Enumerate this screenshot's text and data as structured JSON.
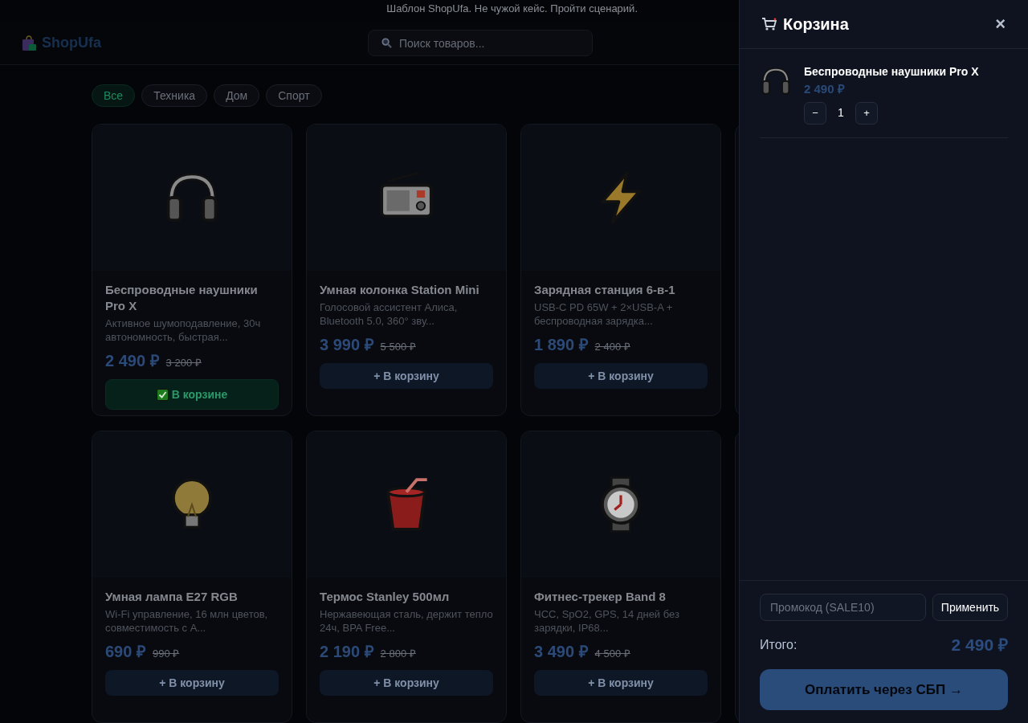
{
  "banner": "Шаблон ShopUfa. Не чужой кейс. Пройти сценарий.",
  "logo": "ShopUfa",
  "search": {
    "placeholder": "Поиск товаров..."
  },
  "categories": [
    {
      "label": "Все",
      "selected": true
    },
    {
      "label": "Техника",
      "selected": false
    },
    {
      "label": "Дом",
      "selected": false
    },
    {
      "label": "Спорт",
      "selected": false
    }
  ],
  "products": [
    {
      "title": "Беспроводные наушники Pro X",
      "description": "Активное шумоподавление, 30ч автономность, быстрая...",
      "price": "2 490 ₽",
      "old_price": "3 200 ₽",
      "in_cart": true,
      "button": "В корзине"
    },
    {
      "title": "Умная колонка Station Mini",
      "description": "Голосовой ассистент Алиса, Bluetooth 5.0, 360° зву...",
      "price": "3 990 ₽",
      "old_price": "5 500 ₽",
      "in_cart": false,
      "button": "+ В корзину"
    },
    {
      "title": "Зарядная станция 6-в-1",
      "description": "USB-C PD 65W + 2×USB-A + беспроводная зарядка...",
      "price": "1 890 ₽",
      "old_price": "2 400 ₽",
      "in_cart": false,
      "button": "+ В корзину"
    },
    {
      "title": "Умная лампа E27 RGB",
      "description": "Wi-Fi управление, 16 млн цветов, совместимость с А...",
      "price": "690 ₽",
      "old_price": "990 ₽",
      "in_cart": false,
      "button": "+ В корзину"
    },
    {
      "title": "Термос Stanley 500мл",
      "description": "Нержавеющая сталь, держит тепло 24ч, BPA Free...",
      "price": "2 190 ₽",
      "old_price": "2 800 ₽",
      "in_cart": false,
      "button": "+ В корзину"
    },
    {
      "title": "Фитнес-трекер Band 8",
      "description": "ЧСС, SpO2, GPS, 14 дней без зарядки, IP68...",
      "price": "3 490 ₽",
      "old_price": "4 500 ₽",
      "in_cart": false,
      "button": "+ В корзину"
    }
  ],
  "cart": {
    "title": "Корзина",
    "close": "×",
    "items": [
      {
        "name": "Беспроводные наушники Pro X",
        "price": "2 490 ₽",
        "minus": "−",
        "quantity": "1",
        "plus": "+"
      }
    ],
    "promo": {
      "placeholder": "Промокод (SALE10)"
    },
    "apply": "Применить",
    "total_label": "Итого:",
    "total": "2 490 ₽",
    "pay": "Оплатить через СБП →"
  }
}
